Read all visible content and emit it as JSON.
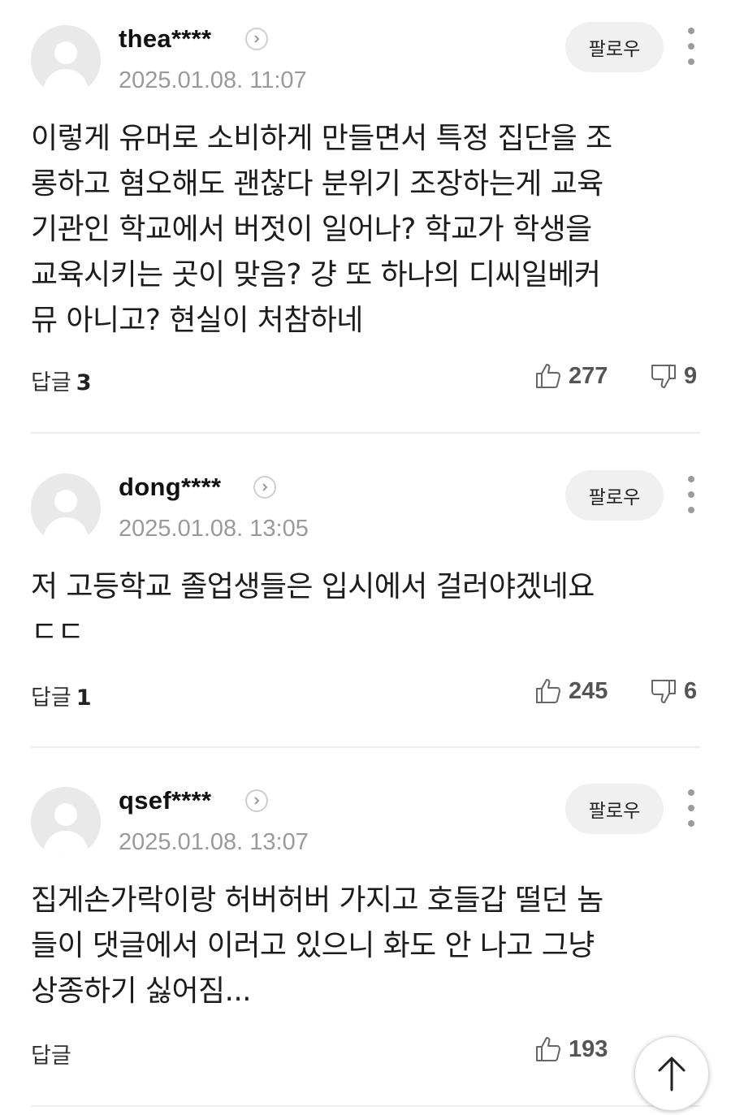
{
  "follow_label": "팔로우",
  "reply_label": "답글",
  "comments": [
    {
      "username": "thea****",
      "date": "2025.01.08. 11:07",
      "text": "이렇게 유머로 소비하게 만들면서 특정 집단을 조\n롱하고 혐오해도 괜찮다 분위기 조장하는게 교육\n기관인 학교에서 버젓이 일어나? 학교가 학생을\n교육시키는 곳이 맞음? 걍 또 하나의 디씨일베커\n뮤 아니고? 현실이 처참하네",
      "reply_count": "3",
      "likes": "277",
      "dislikes": "9"
    },
    {
      "username": "dong****",
      "date": "2025.01.08. 13:05",
      "text": "저 고등학교 졸업생들은 입시에서 걸러야겠네요\nㄷㄷ",
      "reply_count": "1",
      "likes": "245",
      "dislikes": "6"
    },
    {
      "username": "qsef****",
      "date": "2025.01.08. 13:07",
      "text": "집게손가락이랑 허버허버 가지고 호들갑 떨던 놈\n들이 댓글에서 이러고 있으니 화도 안 나고 그냥\n상종하기 싫어짐...",
      "reply_count": "",
      "likes": "193",
      "dislikes": ""
    }
  ],
  "icons": {
    "avatar": "default-profile-icon",
    "chevron": "chevron-right-icon",
    "more": "more-vertical-icon",
    "like": "thumbs-up-icon",
    "dislike": "thumbs-down-icon",
    "scroll_top": "arrow-up-icon"
  },
  "colors": {
    "avatar_bg": "#e9e9e9",
    "follow_bg": "#f0f0f0",
    "date": "#9a9a9a"
  }
}
